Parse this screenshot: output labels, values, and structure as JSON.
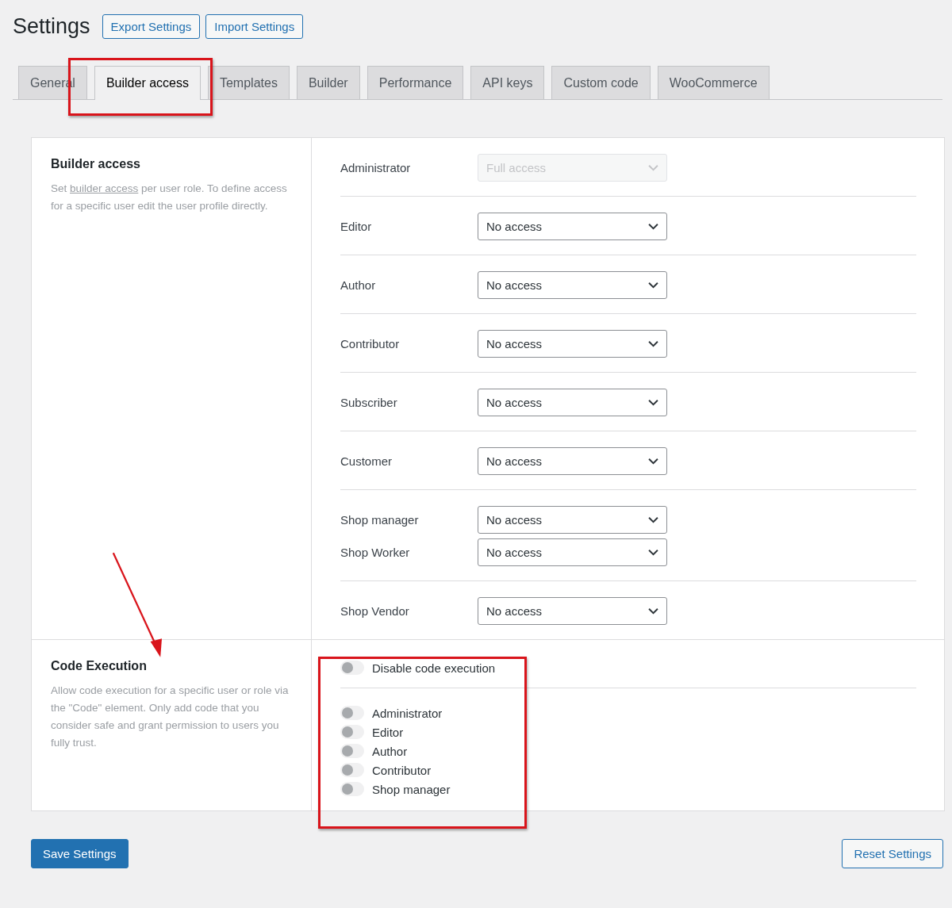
{
  "header": {
    "title": "Settings",
    "buttons": [
      "Export Settings",
      "Import Settings"
    ]
  },
  "tabs": [
    {
      "label": "General",
      "selected": false
    },
    {
      "label": "Builder access",
      "selected": true
    },
    {
      "label": "Templates",
      "selected": false
    },
    {
      "label": "Builder",
      "selected": false
    },
    {
      "label": "Performance",
      "selected": false
    },
    {
      "label": "API keys",
      "selected": false
    },
    {
      "label": "Custom code",
      "selected": false
    },
    {
      "label": "WooCommerce",
      "selected": false
    }
  ],
  "builder_access": {
    "title": "Builder access",
    "link": "builder access",
    "description_after": "per user role. To define access for a specific user edit the user profile directly.",
    "description_before": "Set",
    "groups": [
      {
        "roles": [
          {
            "label": "Administrator",
            "value": "Full access",
            "disabled": true
          }
        ]
      },
      {
        "roles": [
          {
            "label": "Editor",
            "value": "No access",
            "disabled": false
          }
        ]
      },
      {
        "roles": [
          {
            "label": "Author",
            "value": "No access",
            "disabled": false
          }
        ]
      },
      {
        "roles": [
          {
            "label": "Contributor",
            "value": "No access",
            "disabled": false
          }
        ]
      },
      {
        "roles": [
          {
            "label": "Subscriber",
            "value": "No access",
            "disabled": false
          }
        ]
      },
      {
        "roles": [
          {
            "label": "Customer",
            "value": "No access",
            "disabled": false
          }
        ]
      },
      {
        "roles": [
          {
            "label": "Shop manager",
            "value": "No access",
            "disabled": false
          },
          {
            "label": "Shop Worker",
            "value": "No access",
            "disabled": false
          }
        ]
      },
      {
        "roles": [
          {
            "label": "Shop Vendor",
            "value": "No access",
            "disabled": false
          }
        ]
      }
    ]
  },
  "code_execution": {
    "title": "Code Execution",
    "description": "Allow code execution for a specific user or role via the \"Code\" element. Only add code that you consider safe and grant permission to users you fully trust.",
    "disable_toggle": {
      "label": "Disable code execution",
      "on": false
    },
    "roles": [
      {
        "label": "Administrator",
        "on": false
      },
      {
        "label": "Editor",
        "on": false
      },
      {
        "label": "Author",
        "on": false
      },
      {
        "label": "Contributor",
        "on": false
      },
      {
        "label": "Shop manager",
        "on": false
      }
    ]
  },
  "footer": {
    "save": "Save Settings",
    "reset": "Reset Settings"
  }
}
